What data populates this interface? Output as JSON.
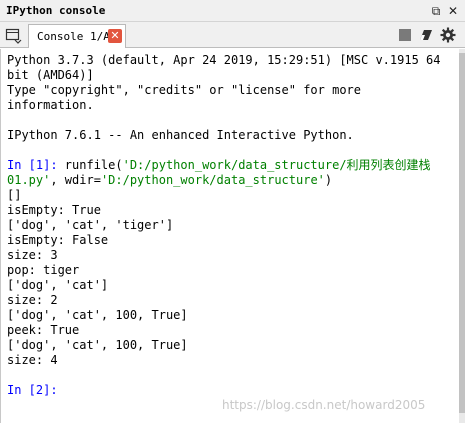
{
  "window": {
    "title": "IPython console",
    "undock_glyph": "⧉",
    "close_glyph": "✕"
  },
  "tab": {
    "label": "Console 1/A",
    "close_glyph": "✕"
  },
  "toolbar": {
    "icons": [
      "browse-tabs-icon",
      "stop-icon",
      "eraser-icon",
      "gear-icon"
    ]
  },
  "console": {
    "banner_1": "Python 3.7.3 (default, Apr 24 2019, 15:29:51) [MSC v.1915 64",
    "banner_2": "bit (AMD64)]",
    "banner_3": "Type \"copyright\", \"credits\" or \"license\" for more",
    "banner_4": "information.",
    "banner_5": "IPython 7.6.1 -- An enhanced Interactive Python.",
    "in1_prompt": "In [1]: ",
    "in1_cmd_a": "runfile(",
    "in1_str_a": "'D:/python_work/data_structure/利用列表创建栈",
    "in1_str_b": "01.py'",
    "in1_cmd_b": ", wdir=",
    "in1_str_c": "'D:/python_work/data_structure'",
    "in1_cmd_c": ")",
    "output": [
      "[]",
      "isEmpty: True",
      "['dog', 'cat', 'tiger']",
      "isEmpty: False",
      "size: 3",
      "pop: tiger",
      "['dog', 'cat']",
      "size: 2",
      "['dog', 'cat', 100, True]",
      "peek: True",
      "['dog', 'cat', 100, True]",
      "size: 4"
    ],
    "in2_prompt": "In [2]:"
  },
  "watermark": "https://blog.csdn.net/howard2005",
  "colors": {
    "prompt": "#0000ff",
    "string": "#008000",
    "tab_close": "#e2553e"
  }
}
